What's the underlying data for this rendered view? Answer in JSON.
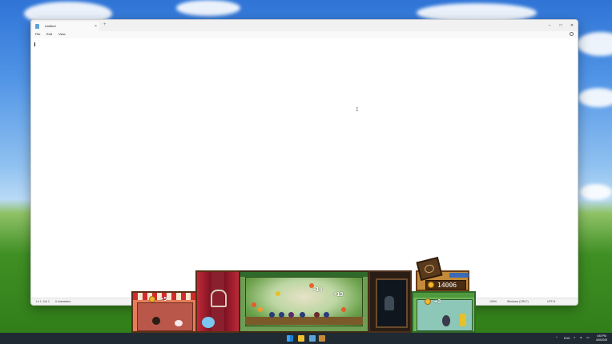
{
  "window": {
    "tab_title": "Untitled",
    "tab_close": "×",
    "new_tab": "+",
    "controls": {
      "minimize": "–",
      "maximize": "□",
      "close": "✕"
    }
  },
  "menu": {
    "file": "File",
    "edit": "Edit",
    "view": "View"
  },
  "editor": {
    "content": ""
  },
  "status": {
    "position": "Ln 1, Col 1",
    "characters": "0 characters",
    "zoom": "100%",
    "line_ending": "Windows (CRLF)",
    "encoding": "UTF-8"
  },
  "game": {
    "coins": "14006",
    "labels": {
      "p1": "+5",
      "p3_left": "+14",
      "p3_right": "+13",
      "p5": "+3"
    }
  },
  "taskbar": {
    "language": "ENG",
    "time": "4:53 PM",
    "date": "4/16/2025",
    "icons": [
      "windows-start-icon",
      "file-explorer-icon",
      "notepad-icon",
      "game-icon"
    ]
  }
}
